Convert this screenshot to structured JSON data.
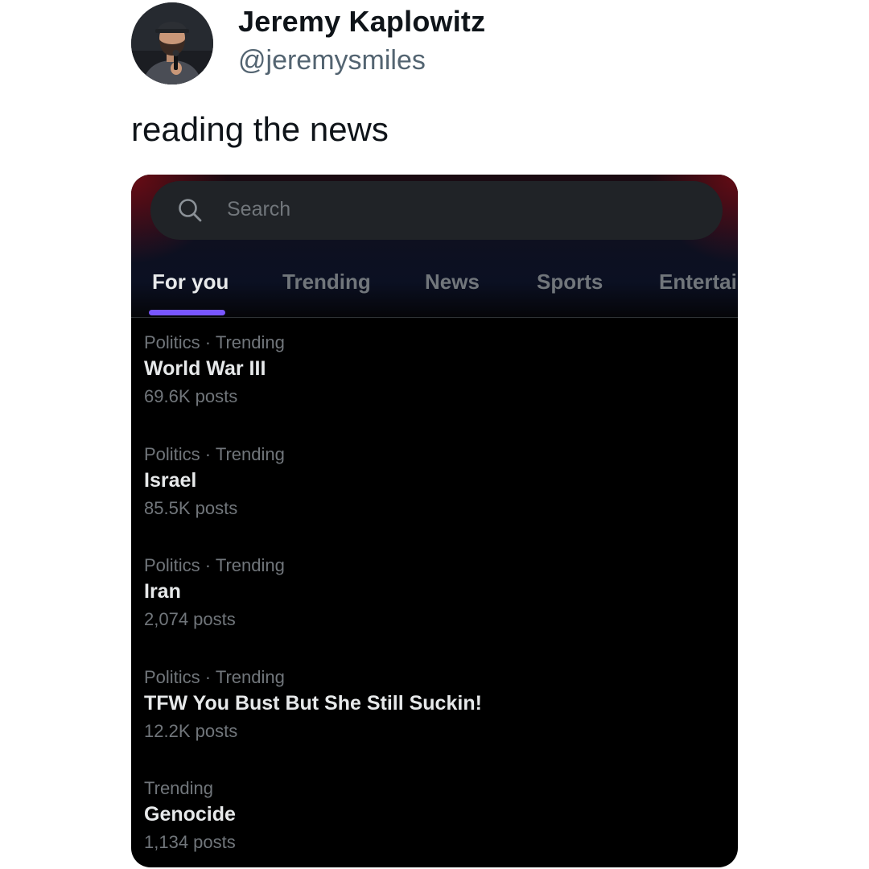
{
  "tweet": {
    "author_name": "Jeremy Kaplowitz",
    "author_handle": "@jeremysmiles",
    "text": "reading the news"
  },
  "screenshot": {
    "search": {
      "placeholder": "Search",
      "icon": "search-icon"
    },
    "tabs": [
      {
        "label": "For you",
        "active": true
      },
      {
        "label": "Trending",
        "active": false
      },
      {
        "label": "News",
        "active": false
      },
      {
        "label": "Sports",
        "active": false
      },
      {
        "label": "Entertai",
        "active": false
      }
    ],
    "trends": [
      {
        "meta": "Politics · Trending",
        "title": "World War III",
        "count": "69.6K posts"
      },
      {
        "meta": "Politics · Trending",
        "title": "Israel",
        "count": "85.5K posts"
      },
      {
        "meta": "Politics · Trending",
        "title": "Iran",
        "count": "2,074 posts"
      },
      {
        "meta": "Politics · Trending",
        "title": "TFW You Bust But She Still Suckin!",
        "count": "12.2K posts"
      },
      {
        "meta": "Trending",
        "title": "Genocide",
        "count": "1,134 posts"
      }
    ],
    "colors": {
      "background": "#000000",
      "search_bg": "#202327",
      "active_tab_indicator": "#7856ff",
      "secondary_text": "#71767b",
      "primary_text": "#e7e9ea"
    }
  }
}
